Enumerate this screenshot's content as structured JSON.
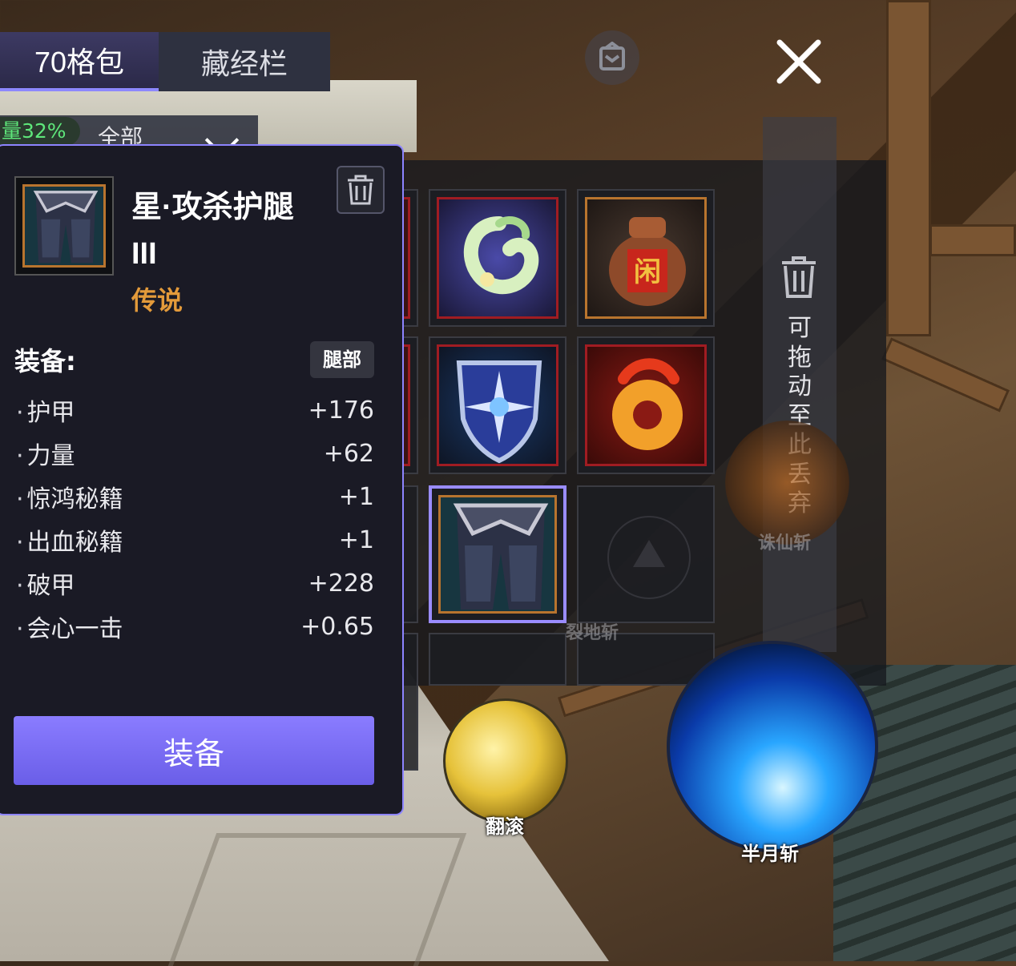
{
  "tabs": [
    {
      "label": "70格包",
      "active": true
    },
    {
      "label": "藏经栏",
      "active": false
    }
  ],
  "filter": {
    "weight_text": "量32%",
    "category": "全部"
  },
  "icons": {
    "sort": "sort-icon",
    "close": "close-icon",
    "trash": "trash-icon",
    "filter_toggle": "chevron-down-icon"
  },
  "discard_zone": {
    "text": "可拖动至此丢弃"
  },
  "inventory": {
    "items": [
      {
        "icon": "jade-dragon-ring-icon",
        "frame": "#a01c22"
      },
      {
        "icon": "wine-jar-icon",
        "frame": "#b8742e",
        "jar_glyph": "闲"
      },
      {
        "icon": "star-shield-icon",
        "frame": "#a01c22"
      },
      {
        "icon": "fire-dragon-jade-icon",
        "frame": "#a01c22"
      },
      {
        "icon": "leg-armor-icon",
        "frame": "#b8742e",
        "selected": true
      }
    ]
  },
  "skills": {
    "roll": "翻滚",
    "half_moon": "半月斩",
    "ground_split": "裂地斩",
    "zhuxian": "诛仙斩"
  },
  "tooltip": {
    "name": "星·攻杀护腿 III",
    "rarity": "传说",
    "rarity_color": "#e39a3a",
    "section_label": "装备:",
    "slot_label": "腿部",
    "stats": [
      {
        "name": "护甲",
        "value": "+176"
      },
      {
        "name": "力量",
        "value": "+62"
      },
      {
        "name": "惊鸿秘籍",
        "value": "+1"
      },
      {
        "name": "出血秘籍",
        "value": "+1"
      },
      {
        "name": "破甲",
        "value": "+228"
      },
      {
        "name": "会心一击",
        "value": "+0.65"
      }
    ],
    "equip_button": "装备"
  },
  "colors": {
    "accent": "#8d84ff",
    "weight_text": "#5ee67a",
    "legendary": "#e39a3a"
  }
}
